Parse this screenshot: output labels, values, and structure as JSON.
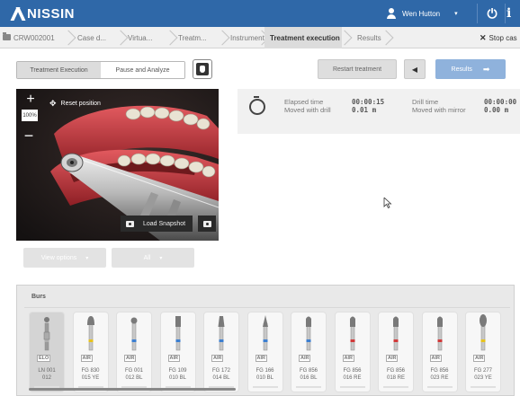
{
  "topbar": {
    "logo": "NISSIN",
    "user_name": "Wen Hutton",
    "user_caret": "▾",
    "power_icon": "⏻",
    "info_icon": "i"
  },
  "breadcrumb": {
    "items": [
      {
        "label": "CRW002001"
      },
      {
        "label": "Case d..."
      },
      {
        "label": "Virtua..."
      },
      {
        "label": "Treatm..."
      },
      {
        "label": "Instruments"
      },
      {
        "label": "Treatment execution"
      },
      {
        "label": "Results"
      }
    ],
    "stop_label": "Stop cas",
    "stop_x": "✕"
  },
  "toolbar": {
    "mode_left": "Treatment Execution",
    "mode_right": "Pause and Analyze",
    "restart_label": "Restart treatment",
    "prev_label": "◀",
    "results_label": "Results",
    "results_arrow": "➡"
  },
  "viewport": {
    "zoom_in": "+",
    "zoom_level": "100%",
    "zoom_out": "−",
    "reset_label": "Reset position",
    "move_icon": "✥",
    "snapshot_label": "Load Snapshot"
  },
  "controls": {
    "view_options": "View options",
    "all": "All",
    "caret": "▾"
  },
  "stats": {
    "elapsed_label": "Elapsed time",
    "elapsed_value": "00:00:15",
    "moved_drill_label": "Moved with drill",
    "moved_drill_value": "0.01 m",
    "drill_time_label": "Drill time",
    "drill_time_value": "00:00:00",
    "moved_mirror_label": "Moved with mirror",
    "moved_mirror_value": "0.00 m"
  },
  "burs": {
    "title": "Burs",
    "items": [
      {
        "tag": "ELO",
        "line1": "LN 001",
        "line2": "012",
        "band": "#b0b0b0",
        "shape": "round-small",
        "selected": true
      },
      {
        "tag": "AIR",
        "line1": "FG 830",
        "line2": "015 YE",
        "band": "#e6c21e",
        "shape": "pear"
      },
      {
        "tag": "AIR",
        "line1": "FG 001",
        "line2": "012 BL",
        "band": "#3d7fd0",
        "shape": "round"
      },
      {
        "tag": "AIR",
        "line1": "FG 109",
        "line2": "010 BL",
        "band": "#3d7fd0",
        "shape": "cyl"
      },
      {
        "tag": "AIR",
        "line1": "FG 172",
        "line2": "014 BL",
        "band": "#3d7fd0",
        "shape": "taper"
      },
      {
        "tag": "AIR",
        "line1": "FG 166",
        "line2": "010 BL",
        "band": "#3d7fd0",
        "shape": "needle"
      },
      {
        "tag": "AIR",
        "line1": "FG 856",
        "line2": "016 BL",
        "band": "#3d7fd0",
        "shape": "cham"
      },
      {
        "tag": "AIR",
        "line1": "FG 856",
        "line2": "016 RE",
        "band": "#d03a3a",
        "shape": "cham"
      },
      {
        "tag": "AIR",
        "line1": "FG 856",
        "line2": "018 RE",
        "band": "#d03a3a",
        "shape": "cham"
      },
      {
        "tag": "AIR",
        "line1": "FG 856",
        "line2": "023 RE",
        "band": "#d03a3a",
        "shape": "cham"
      },
      {
        "tag": "AIR",
        "line1": "FG 277",
        "line2": "023 YE",
        "band": "#e6c21e",
        "shape": "egg"
      }
    ]
  },
  "colors": {
    "topbar": "#2f68a8",
    "results_button": "#8fb2dc",
    "gum": "#c8383e"
  }
}
